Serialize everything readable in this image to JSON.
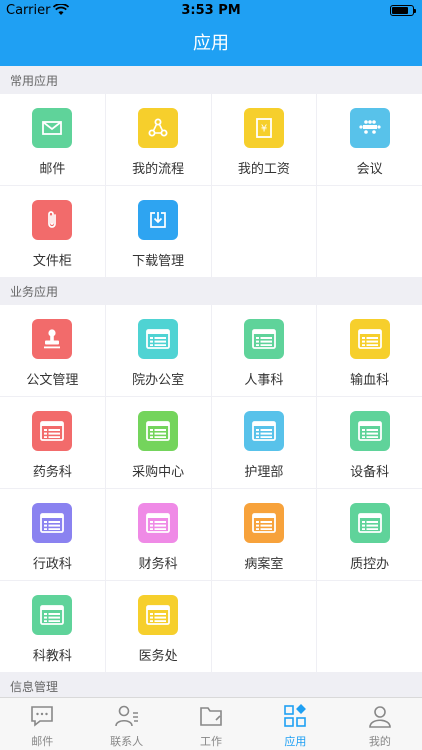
{
  "status_bar": {
    "carrier": "Carrier",
    "time": "3:53 PM"
  },
  "nav": {
    "title": "应用"
  },
  "sections": [
    {
      "title": "常用应用",
      "items": [
        {
          "label": "邮件",
          "color": "#5fd39a",
          "icon": "mail-icon"
        },
        {
          "label": "我的流程",
          "color": "#f6cf2c",
          "icon": "workflow-icon"
        },
        {
          "label": "我的工资",
          "color": "#f6cf2c",
          "icon": "salary-icon"
        },
        {
          "label": "会议",
          "color": "#58c2ea",
          "icon": "meeting-icon"
        },
        {
          "label": "文件柜",
          "color": "#f26b6b",
          "icon": "paperclip-icon"
        },
        {
          "label": "下载管理",
          "color": "#2ea4f1",
          "icon": "download-icon"
        }
      ]
    },
    {
      "title": "业务应用",
      "items": [
        {
          "label": "公文管理",
          "color": "#f26b6b",
          "icon": "stamp-icon"
        },
        {
          "label": "院办公室",
          "color": "#4fd3d3",
          "icon": "browser-window-icon"
        },
        {
          "label": "人事科",
          "color": "#5fd39a",
          "icon": "browser-window-icon"
        },
        {
          "label": "输血科",
          "color": "#f6cf2c",
          "icon": "browser-window-icon"
        },
        {
          "label": "药务科",
          "color": "#f26b6b",
          "icon": "browser-window-icon"
        },
        {
          "label": "采购中心",
          "color": "#74d45c",
          "icon": "browser-window-icon"
        },
        {
          "label": "护理部",
          "color": "#58c2ea",
          "icon": "browser-window-icon"
        },
        {
          "label": "设备科",
          "color": "#5fd39a",
          "icon": "browser-window-icon"
        },
        {
          "label": "行政科",
          "color": "#8a82f0",
          "icon": "browser-window-icon"
        },
        {
          "label": "财务科",
          "color": "#ef8ae6",
          "icon": "browser-window-icon"
        },
        {
          "label": "病案室",
          "color": "#f7a23b",
          "icon": "browser-window-icon"
        },
        {
          "label": "质控办",
          "color": "#5fd39a",
          "icon": "browser-window-icon"
        },
        {
          "label": "科教科",
          "color": "#5fd39a",
          "icon": "browser-window-icon"
        },
        {
          "label": "医务处",
          "color": "#f6cf2c",
          "icon": "browser-window-icon"
        }
      ]
    },
    {
      "title": "信息管理",
      "items": []
    }
  ],
  "tabs": [
    {
      "label": "邮件",
      "icon": "chat-icon",
      "active": false
    },
    {
      "label": "联系人",
      "icon": "contacts-icon",
      "active": false
    },
    {
      "label": "工作",
      "icon": "folder-icon",
      "active": false
    },
    {
      "label": "应用",
      "icon": "apps-grid-icon",
      "active": true
    },
    {
      "label": "我的",
      "icon": "profile-icon",
      "active": false
    }
  ],
  "colors": {
    "accent": "#1fa0f3",
    "inactive": "#888888"
  }
}
